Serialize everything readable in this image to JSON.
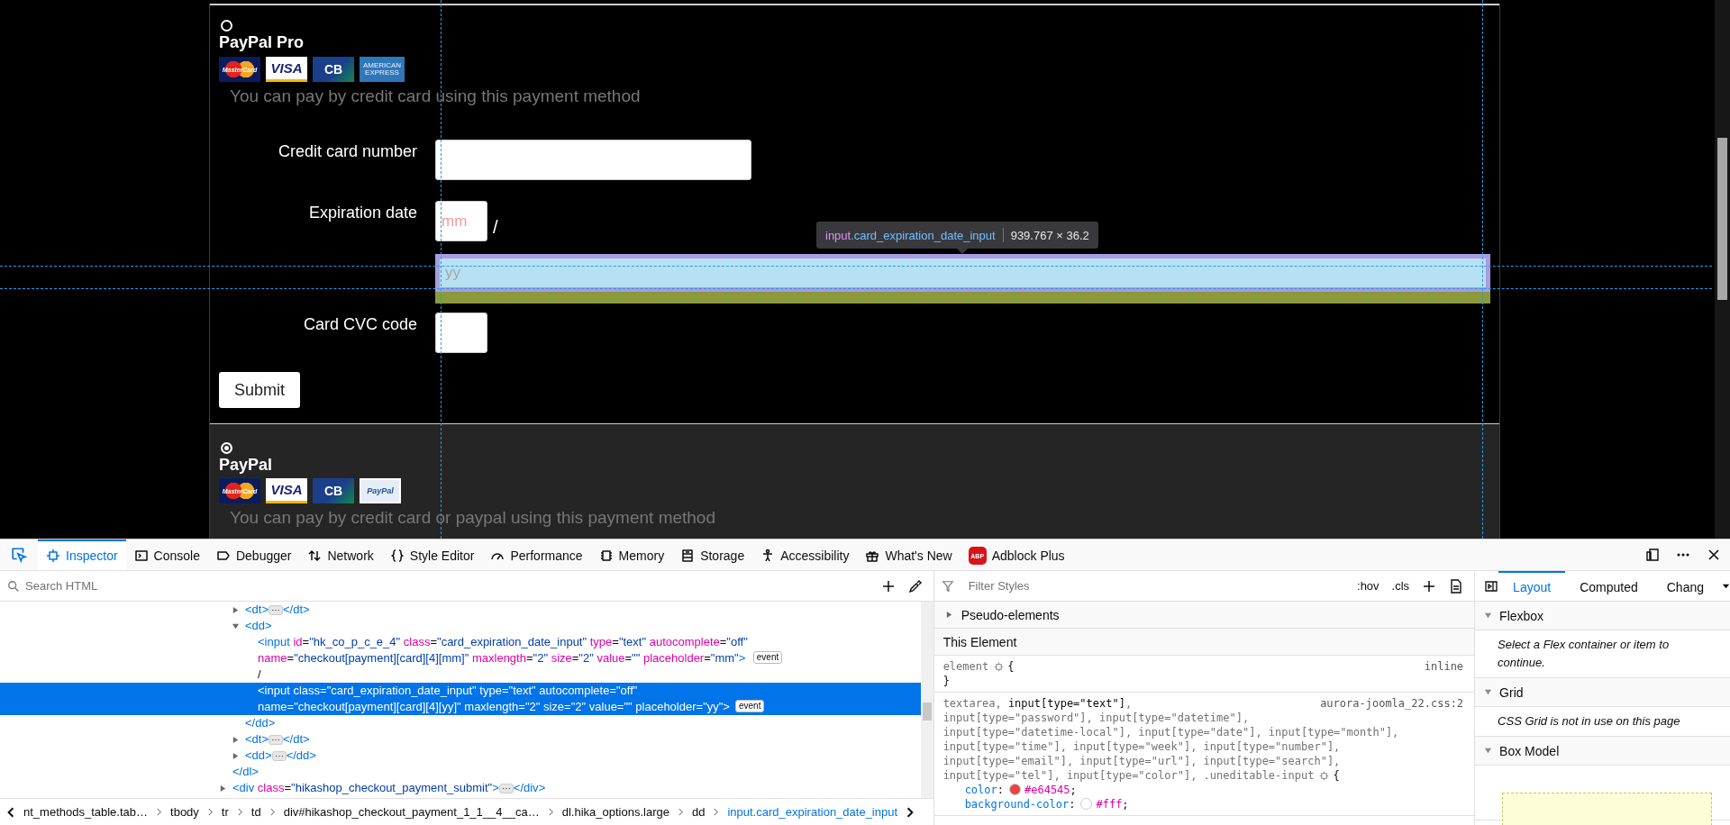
{
  "page": {
    "payment_methods": [
      {
        "name": "PayPal Pro",
        "selected": false,
        "cards": [
          {
            "kind": "mastercard",
            "label": "MasterCard"
          },
          {
            "kind": "visa",
            "label": "VISA"
          },
          {
            "kind": "cb",
            "label": "CB"
          },
          {
            "kind": "amex",
            "label": "AMERICAN EXPRESS"
          }
        ],
        "description": "You can pay by credit card using this payment method",
        "form": {
          "fields": [
            {
              "kind": "text",
              "label": "Credit card number"
            },
            {
              "kind": "expiry",
              "label": "Expiration date",
              "month_placeholder": "mm",
              "separator": "/",
              "year_placeholder": "yy",
              "highlighted": true
            },
            {
              "kind": "short",
              "label": "Card CVC code"
            }
          ],
          "submit": "Submit"
        }
      },
      {
        "name": "PayPal",
        "selected": true,
        "cards": [
          {
            "kind": "mastercard",
            "label": "MasterCard"
          },
          {
            "kind": "visa",
            "label": "VISA"
          },
          {
            "kind": "cb",
            "label": "CB"
          },
          {
            "kind": "paypal",
            "label": "PayPal"
          }
        ],
        "description": "You can pay by credit card or paypal using this payment method"
      }
    ],
    "highlight_tooltip": {
      "selector": "input.card_expiration_date_input",
      "size": "939.767 × 36.2"
    }
  },
  "devtools": {
    "tabs": [
      {
        "label": "Inspector",
        "selected": true
      },
      {
        "label": "Console",
        "selected": false
      },
      {
        "label": "Debugger",
        "selected": false
      },
      {
        "label": "Network",
        "selected": false
      },
      {
        "label": "Style Editor",
        "selected": false
      },
      {
        "label": "Performance",
        "selected": false
      },
      {
        "label": "Memory",
        "selected": false
      },
      {
        "label": "Storage",
        "selected": false
      },
      {
        "label": "Accessibility",
        "selected": false
      },
      {
        "label": "What's New",
        "selected": false
      },
      {
        "label": "Adblock Plus",
        "selected": false,
        "badge": "ABP"
      }
    ],
    "markup": {
      "search_placeholder": "Search HTML",
      "tree": [
        {
          "close": "</dl>",
          "children": [
            {
              "lines": [
                "<dt>⋯</dt>"
              ],
              "expanded": false,
              "selected": false
            },
            {
              "lines": [
                "<dd>"
              ],
              "expanded": true,
              "selected": false,
              "close": "</dd>",
              "children": [
                {
                  "lines": [
                    "<input id=\"hk_co_p_c_e_4\" class=\"card_expiration_date_input\" type=\"text\" autocomplete=\"off\"",
                    "name=\"checkout[payment][card][4][mm]\" maxlength=\"2\" size=\"2\" value=\"\" placeholder=\"mm\">"
                  ],
                  "selected": false,
                  "badge": "event"
                },
                {
                  "lines": [
                    "/"
                  ],
                  "selected": false
                },
                {
                  "lines": [
                    "<input class=\"card_expiration_date_input\" type=\"text\" autocomplete=\"off\"",
                    "name=\"checkout[payment][card][4][yy]\" maxlength=\"2\" size=\"2\" value=\"\" placeholder=\"yy\">"
                  ],
                  "selected": true,
                  "badge": "event"
                }
              ]
            },
            {
              "lines": [
                "<dt>⋯</dt>"
              ],
              "expanded": false,
              "selected": false
            },
            {
              "lines": [
                "<dd>⋯</dd>"
              ],
              "expanded": false,
              "selected": false
            }
          ]
        },
        {
          "lines": [
            "<div class=\"hikashop_checkout_payment_submit\">⋯</div>"
          ],
          "expanded": false,
          "selected": false
        }
      ],
      "breadcrumbs": [
        {
          "label": "nt_methods_table.tab…",
          "selected": false
        },
        {
          "label": "tbody",
          "selected": false
        },
        {
          "label": "tr",
          "selected": false
        },
        {
          "label": "td",
          "selected": false
        },
        {
          "label": "div#hikashop_checkout_payment_1_1__4__ca…",
          "selected": false
        },
        {
          "label": "dl.hika_options.large",
          "selected": false
        },
        {
          "label": "dd",
          "selected": false
        },
        {
          "label": "input.card_expiration_date_input",
          "selected": true
        }
      ]
    },
    "rules": {
      "filter_placeholder": "Filter Styles",
      "hov": ":hov",
      "cls": ".cls",
      "pseudo_elements": "Pseudo-elements",
      "section_title": "This Element",
      "list": [
        {
          "selector_lines": [
            "element"
          ],
          "open_brace": "{",
          "close_brace": "}",
          "source": "inline"
        },
        {
          "selector_lines": [
            "textarea, **input[type=\"text\"]**,",
            "input[type=\"password\"], input[type=\"datetime\"],",
            "input[type=\"datetime-local\"], input[type=\"date\"], input[type=\"month\"],",
            "input[type=\"time\"], input[type=\"week\"], input[type=\"number\"],",
            "input[type=\"email\"], input[type=\"url\"], input[type=\"search\"],",
            "input[type=\"tel\"], input[type=\"color\"], .uneditable-input"
          ],
          "open_brace": "{",
          "source": "aurora-joomla_22.css:2",
          "declarations": [
            {
              "property": "color",
              "colon": ":",
              "value": "#e64545",
              "semicolon": ";"
            },
            {
              "property": "background-color",
              "colon": ":",
              "value": "#fff",
              "semicolon": ";"
            }
          ]
        }
      ]
    },
    "sidebar": {
      "tabs": [
        {
          "label": "Layout",
          "selected": true
        },
        {
          "label": "Computed",
          "selected": false
        },
        {
          "label": "Chang",
          "selected": false
        }
      ],
      "sections": [
        {
          "title": "Flexbox",
          "expanded": true,
          "text": "Select a Flex container or item to continue."
        },
        {
          "title": "Grid",
          "expanded": true,
          "text": "CSS Grid is not in use on this page"
        },
        {
          "title": "Box Model",
          "expanded": true
        }
      ]
    }
  }
}
